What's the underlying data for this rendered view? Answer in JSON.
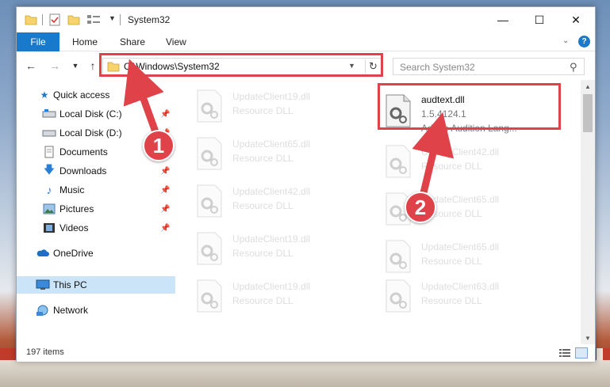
{
  "window": {
    "title": "System32",
    "controls": {
      "minimize": "—",
      "maximize": "☐",
      "close": "✕"
    }
  },
  "ribbon": {
    "tabs": [
      "File",
      "Home",
      "Share",
      "View"
    ],
    "help": "?"
  },
  "navigation": {
    "address": "C:\\Windows\\System32",
    "search_placeholder": "Search System32"
  },
  "sidebar": {
    "items": [
      {
        "label": "Quick access",
        "icon": "star-icon"
      },
      {
        "label": "Local Disk (C:)",
        "icon": "drive-icon",
        "pinned": true
      },
      {
        "label": "Local Disk (D:)",
        "icon": "drive-icon",
        "pinned": true
      },
      {
        "label": "Documents",
        "icon": "documents-icon",
        "pinned": true
      },
      {
        "label": "Downloads",
        "icon": "download-icon",
        "pinned": true
      },
      {
        "label": "Music",
        "icon": "music-icon",
        "pinned": true
      },
      {
        "label": "Pictures",
        "icon": "pictures-icon",
        "pinned": true
      },
      {
        "label": "Videos",
        "icon": "videos-icon",
        "pinned": true
      },
      {
        "label": "OneDrive",
        "icon": "cloud-icon"
      },
      {
        "label": "This PC",
        "icon": "computer-icon",
        "selected": true
      },
      {
        "label": "Network",
        "icon": "network-icon"
      }
    ]
  },
  "files": {
    "highlighted": {
      "name": "audtext.dll",
      "version": "1.5.4124.1",
      "description": "Adobe Audition Lang..."
    },
    "left_column": [
      {
        "name": "UpdateClient19.dll",
        "type": "Resource DLL"
      },
      {
        "name": "UpdateClient65.dll",
        "type": "Resource DLL"
      },
      {
        "name": "UpdateClient42.dll",
        "type": "Resource DLL"
      },
      {
        "name": "UpdateClient19.dll",
        "type": "Resource DLL"
      },
      {
        "name": "UpdateClient19.dll",
        "type": "Resource DLL"
      }
    ],
    "right_column": [
      {
        "name": "UpdateClient42.dll",
        "type": "Resource DLL"
      },
      {
        "name": "UpdateClient65.dll",
        "type": "Resource DLL"
      },
      {
        "name": "UpdateClient65.dll",
        "type": "Resource DLL"
      },
      {
        "name": "UpdateClient63.dll",
        "type": "Resource DLL"
      }
    ]
  },
  "status": {
    "item_count": "197 items"
  },
  "annotations": {
    "step1": "1",
    "step2": "2"
  },
  "colors": {
    "accent": "#1979ca",
    "annotation": "#e0424a",
    "selected_bg": "#cce4f7"
  }
}
